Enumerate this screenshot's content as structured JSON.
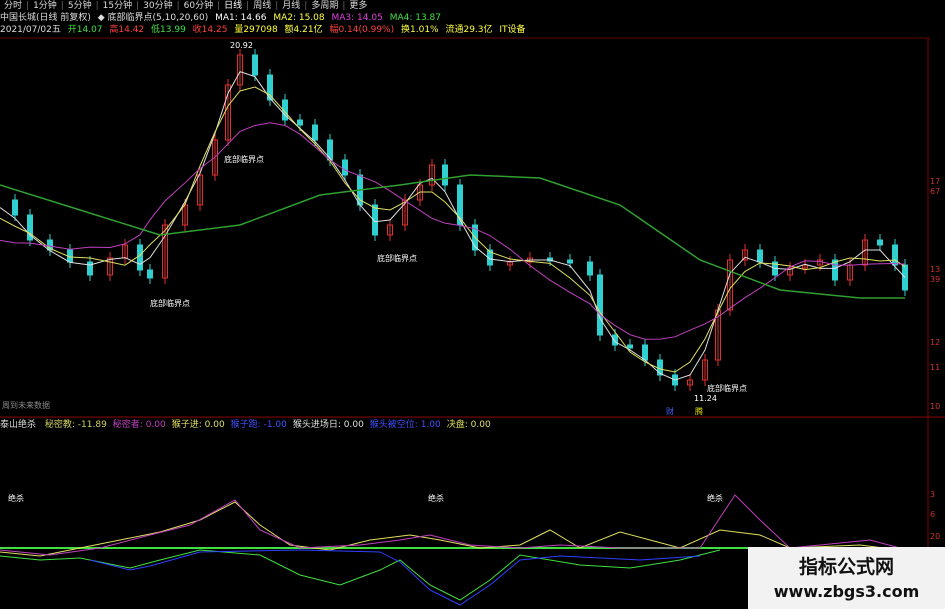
{
  "toolbar": {
    "items": [
      "分时",
      "1分钟",
      "5分钟",
      "15分钟",
      "30分钟",
      "60分钟",
      "日线",
      "周线",
      "月线",
      "多周期",
      "更多"
    ],
    "selected": "日线"
  },
  "header": {
    "stock_name": "中国长城(日线 前复权)",
    "indicator": "◆ 底部临界点(5,10,20,60)",
    "ma1": "MA1: 14.66",
    "ma2": "MA2: 15.08",
    "ma3": "MA3: 14.05",
    "ma4": "MA4: 13.87",
    "date": "2021/07/02五",
    "open": "开14.07",
    "high": "高14.42",
    "low": "低13.99",
    "close": "收14.25",
    "volume": "量297098",
    "amount": "额4.21亿",
    "change": "幅0.14(0.99%)",
    "turnover": "换1.01%",
    "float": "流通29.3亿",
    "sector": "IT设备"
  },
  "annotations": {
    "peak": "20.92",
    "low": "11.24",
    "no_future": "周到未来数据",
    "marker_cai": "财",
    "marker_ji": "腾",
    "bottom_labels": [
      "底部临界点",
      "底部临界点",
      "底部临界点",
      "底部临界点",
      "底部临界点"
    ],
    "sub_markers": [
      "绝杀",
      "绝杀",
      "绝杀"
    ]
  },
  "right_axis": [
    "17",
    "67",
    "13",
    "39",
    "12",
    "11",
    "10",
    "3",
    "6",
    "20",
    "1"
  ],
  "subpanel": {
    "name": "泰山绝杀",
    "items": [
      {
        "label": "秘密教: -11.89",
        "color": "#d0d060"
      },
      {
        "label": "秘密者: 0.00",
        "color": "#c040c0"
      },
      {
        "label": "猴子进: 0.00",
        "color": "#e0e060"
      },
      {
        "label": "猴子跑: -1.00",
        "color": "#4050ff"
      },
      {
        "label": "猴头进场日: 0.00",
        "color": "#e0e0e0"
      },
      {
        "label": "猴头被空位: 1.00",
        "color": "#4050ff"
      },
      {
        "label": "决盘: 0.00",
        "color": "#e0e060"
      }
    ]
  },
  "watermark": {
    "title": "指标公式网",
    "url": "www.zbgs3.com"
  }
}
